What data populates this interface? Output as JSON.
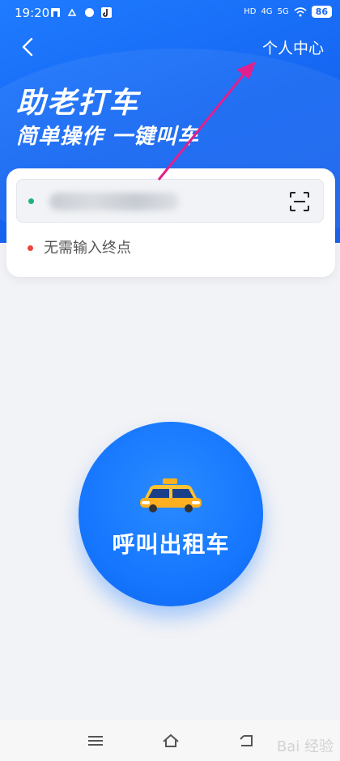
{
  "status": {
    "time": "19:20",
    "battery": "86",
    "signal_labels": [
      "HD",
      "4G",
      "5G"
    ]
  },
  "header": {
    "back_icon": "chevron-left-icon",
    "personal_center": "个人中心"
  },
  "banner": {
    "title": "助老打车",
    "subtitle": "简单操作 一键叫车"
  },
  "route": {
    "origin_value": "",
    "origin_dot_color": "#1fb37a",
    "scan_icon": "scan-icon",
    "destination_placeholder": "无需输入终点",
    "destination_dot_color": "#f0443a"
  },
  "main": {
    "call_button_label": "呼叫出租车",
    "taxi_icon": "taxi-icon"
  },
  "nav": {
    "menu_icon": "menu-icon",
    "home_icon": "home-icon",
    "back_icon": "back-arrow-icon"
  },
  "watermark": "Bai 经验",
  "colors": {
    "accent": "#1677ff",
    "annotation_arrow": "#e0208c"
  }
}
